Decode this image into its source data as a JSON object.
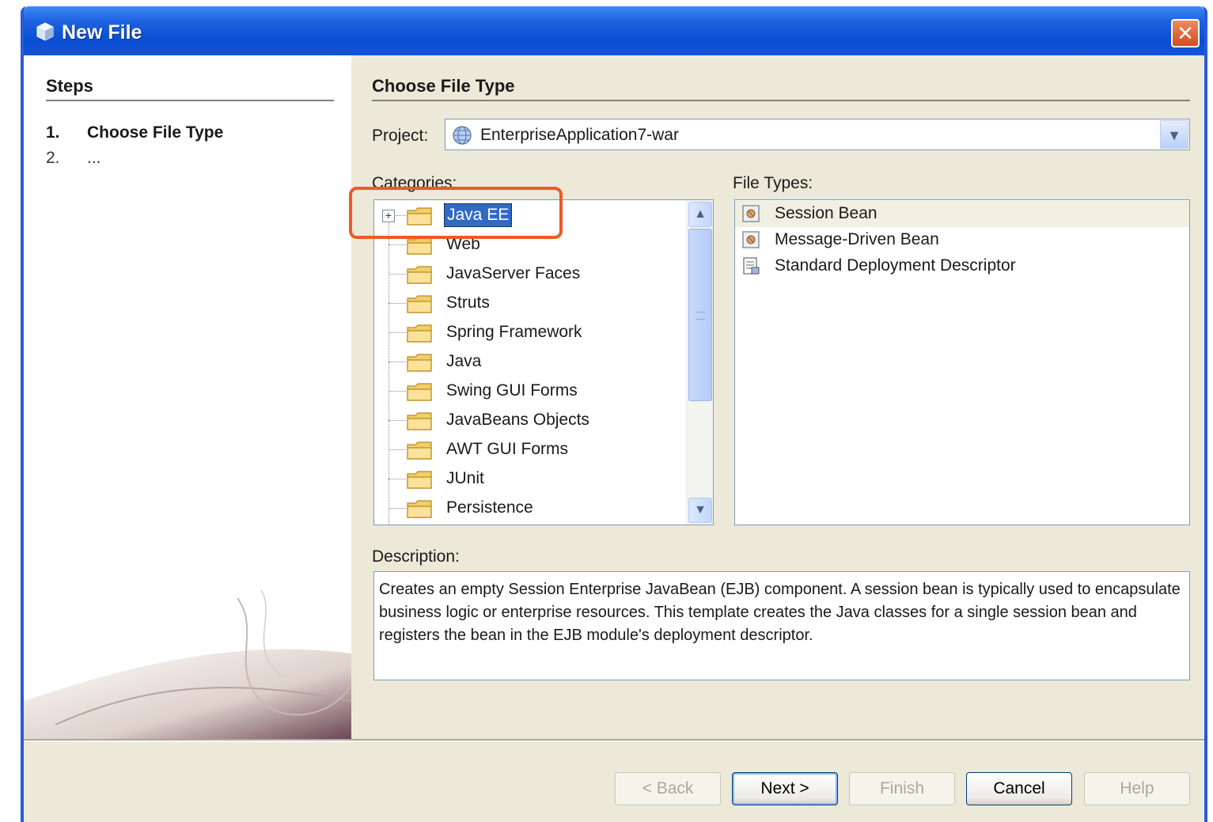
{
  "window": {
    "title": "New File",
    "close_glyph": "✕"
  },
  "steps": {
    "heading": "Steps",
    "items": [
      {
        "num": "1.",
        "label": "Choose File Type"
      },
      {
        "num": "2.",
        "label": "..."
      }
    ]
  },
  "content": {
    "title": "Choose File Type",
    "project_label": "Project:",
    "project_value": "EnterpriseApplication7-war",
    "categories_label": "Categories:",
    "filetypes_label": "File Types:",
    "description_label": "Description:",
    "description_text": "Creates an empty Session Enterprise JavaBean (EJB) component. A session bean is typically used to encapsulate business logic or enterprise resources. This template creates the Java classes for a single session bean and registers the bean in the EJB module's deployment descriptor."
  },
  "categories": [
    {
      "label": "Java EE",
      "selected": true,
      "expandable": true
    },
    {
      "label": "Web"
    },
    {
      "label": "JavaServer Faces"
    },
    {
      "label": "Struts"
    },
    {
      "label": "Spring Framework"
    },
    {
      "label": "Java"
    },
    {
      "label": "Swing GUI Forms"
    },
    {
      "label": "JavaBeans Objects"
    },
    {
      "label": "AWT GUI Forms"
    },
    {
      "label": "JUnit"
    },
    {
      "label": "Persistence"
    }
  ],
  "file_types": [
    {
      "label": "Session Bean",
      "selected": true,
      "icon": "bean-icon"
    },
    {
      "label": "Message-Driven Bean",
      "icon": "bean-icon"
    },
    {
      "label": "Standard Deployment Descriptor",
      "icon": "descriptor-icon"
    }
  ],
  "buttons": {
    "back": "< Back",
    "next": "Next >",
    "finish": "Finish",
    "cancel": "Cancel",
    "help": "Help"
  },
  "colors": {
    "titlebar": "#0a4ed1",
    "selection": "#316ac5",
    "highlight_ring": "#ee5a24"
  }
}
